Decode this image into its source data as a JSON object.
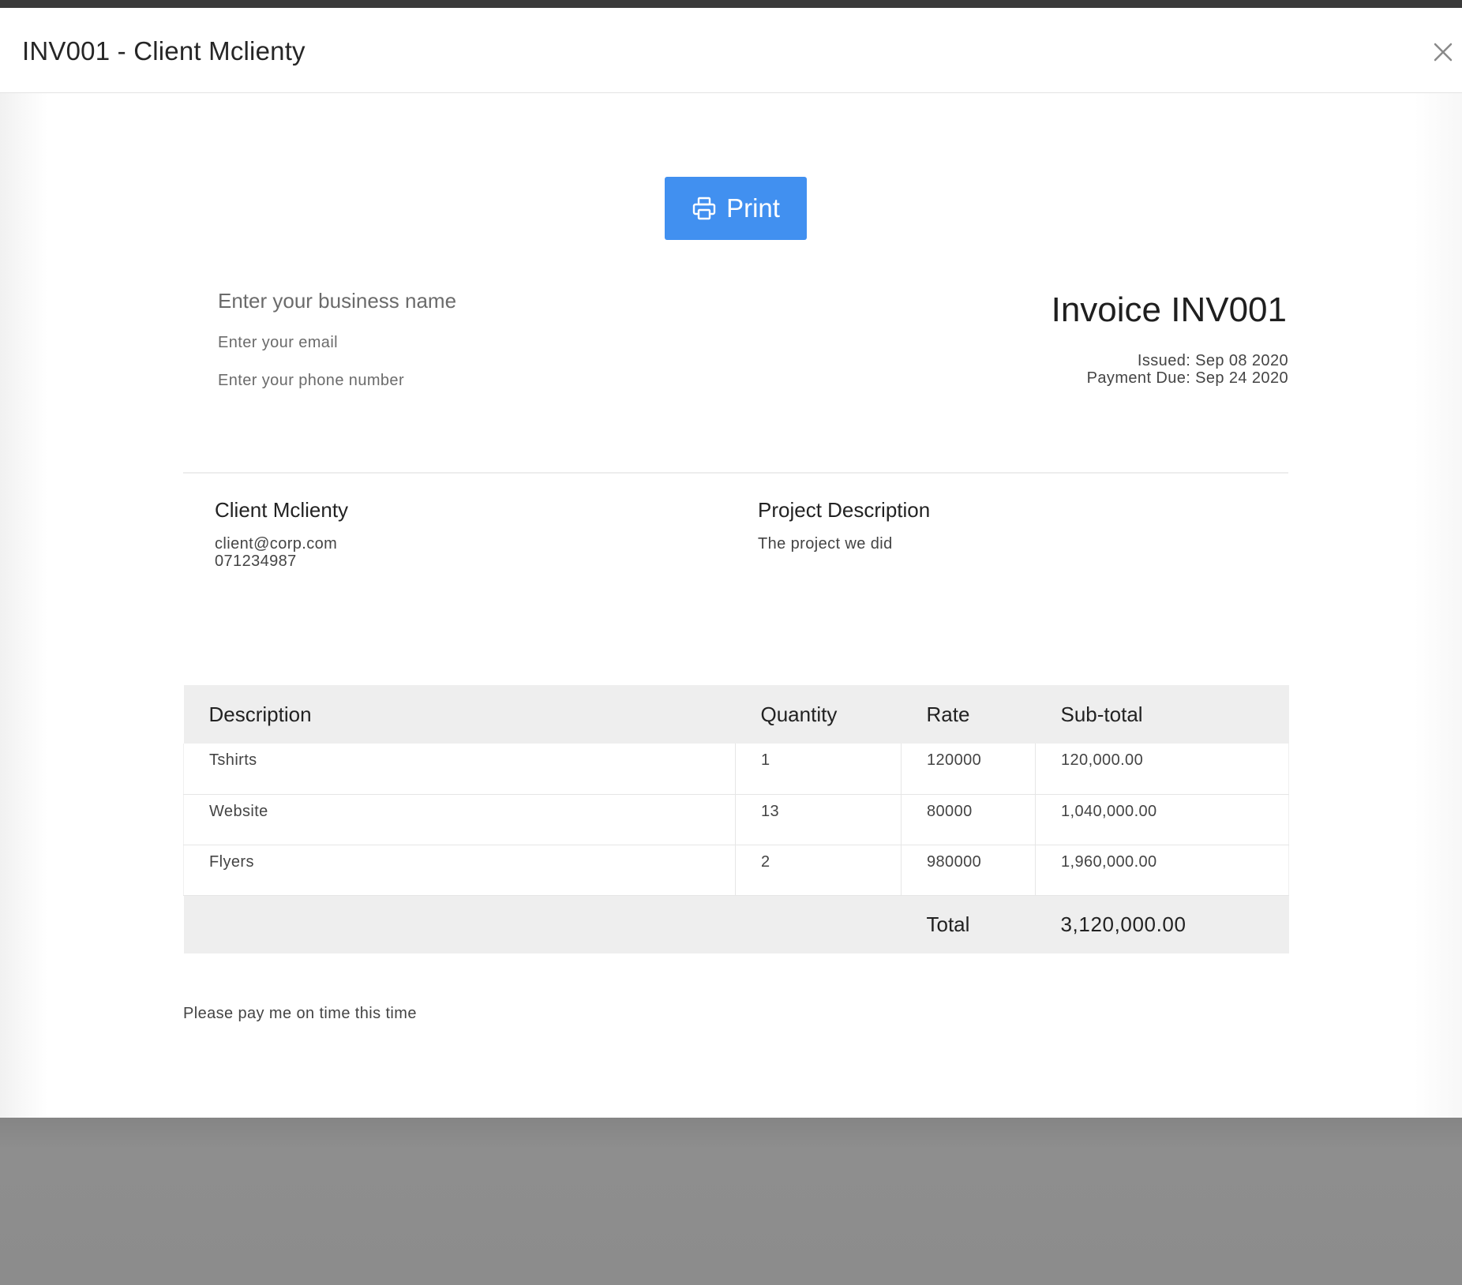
{
  "modal": {
    "title": "INV001 - Client Mclienty",
    "close_icon": "close-icon"
  },
  "toolbar": {
    "print_label": "Print",
    "print_icon": "printer-icon",
    "print_color": "#4190f0"
  },
  "business": {
    "name_placeholder": "Enter your business name",
    "email_placeholder": "Enter your email",
    "phone_placeholder": "Enter your phone number"
  },
  "invoice": {
    "title": "Invoice INV001",
    "issued": "Issued: Sep 08 2020",
    "due": "Payment Due: Sep 24 2020"
  },
  "client": {
    "name": "Client Mclienty",
    "email": "client@corp.com",
    "phone": "071234987"
  },
  "project": {
    "heading": "Project Description",
    "description": "The project we did"
  },
  "table": {
    "headers": [
      "Description",
      "Quantity",
      "Rate",
      "Sub-total"
    ],
    "rows": [
      [
        "Tshirts",
        "1",
        "120000",
        "120,000.00"
      ],
      [
        "Website",
        "13",
        "80000",
        "1,040,000.00"
      ],
      [
        "Flyers",
        "2",
        "980000",
        "1,960,000.00"
      ]
    ],
    "total_label": "Total",
    "total_value": "3,120,000.00"
  },
  "notes": "Please pay me on time this time"
}
